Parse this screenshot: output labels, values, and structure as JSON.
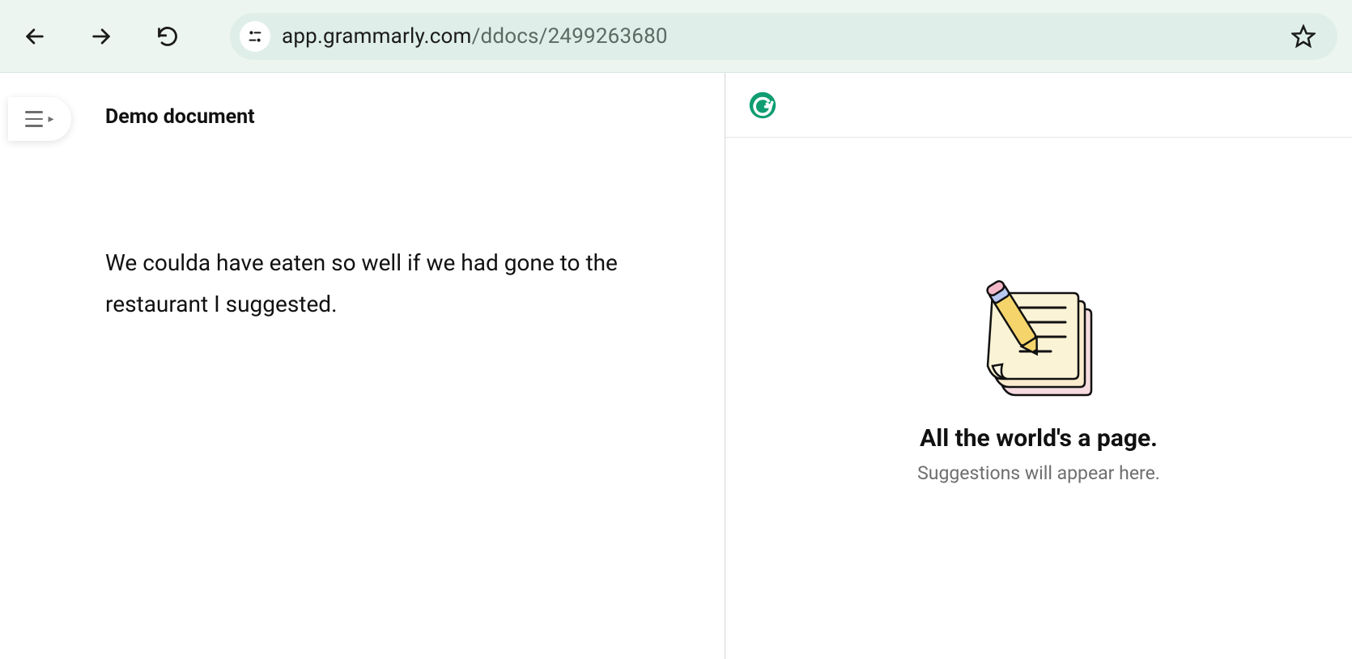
{
  "browser": {
    "url_host": "app.grammarly.com",
    "url_path": "/ddocs/2499263680"
  },
  "editor": {
    "title": "Demo document",
    "body": "We coulda have eaten so well if we had gone to the restaurant I suggested."
  },
  "sidebar": {
    "empty_title": "All the world's a page.",
    "empty_subtitle": "Suggestions will appear here."
  }
}
